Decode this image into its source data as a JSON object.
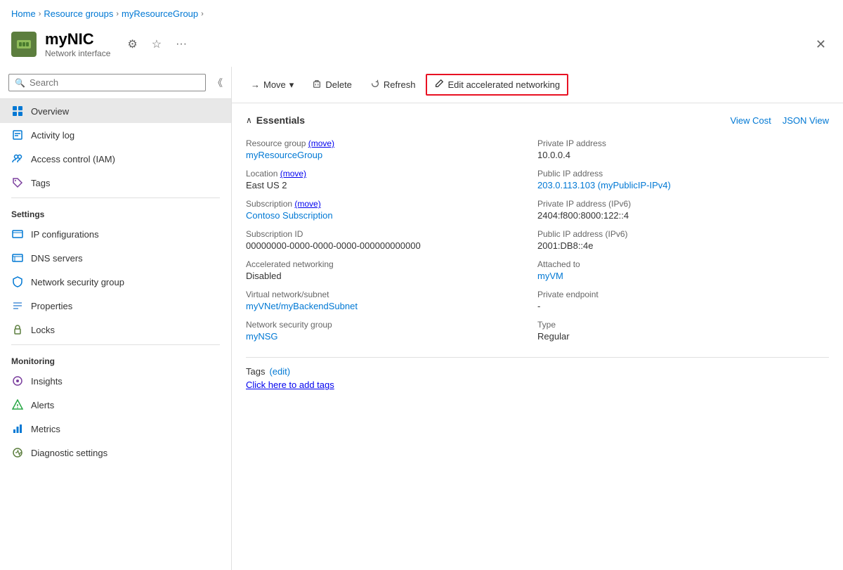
{
  "breadcrumb": {
    "items": [
      "Home",
      "Resource groups",
      "myResourceGroup"
    ]
  },
  "resource": {
    "name": "myNIC",
    "type": "Network interface",
    "icon_bg": "#4a7c2f"
  },
  "header_actions": {
    "pin": "⚙",
    "star": "☆",
    "more": "..."
  },
  "search": {
    "placeholder": "Search"
  },
  "sidebar": {
    "overview": "Overview",
    "sections": [
      {
        "name": "Activity log",
        "icon": "activity"
      },
      {
        "name": "Access control (IAM)",
        "icon": "iam"
      },
      {
        "name": "Tags",
        "icon": "tags"
      }
    ],
    "settings_label": "Settings",
    "settings_items": [
      {
        "name": "IP configurations",
        "icon": "ip"
      },
      {
        "name": "DNS servers",
        "icon": "dns"
      },
      {
        "name": "Network security group",
        "icon": "nsg"
      },
      {
        "name": "Properties",
        "icon": "props"
      },
      {
        "name": "Locks",
        "icon": "locks"
      }
    ],
    "monitoring_label": "Monitoring",
    "monitoring_items": [
      {
        "name": "Insights",
        "icon": "insights"
      },
      {
        "name": "Alerts",
        "icon": "alerts"
      },
      {
        "name": "Metrics",
        "icon": "metrics"
      },
      {
        "name": "Diagnostic settings",
        "icon": "diag"
      }
    ]
  },
  "toolbar": {
    "move_label": "Move",
    "delete_label": "Delete",
    "refresh_label": "Refresh",
    "edit_label": "Edit accelerated networking"
  },
  "essentials": {
    "title": "Essentials",
    "view_cost": "View Cost",
    "json_view": "JSON View",
    "left_fields": [
      {
        "label": "Resource group",
        "value": "myResourceGroup",
        "link": true,
        "suffix": "(move)",
        "suffix_link": true
      },
      {
        "label": "Location",
        "value": "East US 2",
        "link": false,
        "suffix": "(move)",
        "suffix_link": true
      },
      {
        "label": "Subscription",
        "value": "Contoso Subscription",
        "link": true,
        "suffix": "(move)",
        "suffix_link": true
      },
      {
        "label": "Subscription ID",
        "value": "00000000-0000-0000-0000-000000000000",
        "link": false
      },
      {
        "label": "Accelerated networking",
        "value": "Disabled",
        "link": false
      },
      {
        "label": "Virtual network/subnet",
        "value": "myVNet/myBackendSubnet",
        "link": true
      },
      {
        "label": "Network security group",
        "value": "myNSG",
        "link": true
      }
    ],
    "right_fields": [
      {
        "label": "Private IP address",
        "value": "10.0.0.4",
        "link": false
      },
      {
        "label": "Public IP address",
        "value": "203.0.113.103 (myPublicIP-IPv4)",
        "link": true
      },
      {
        "label": "Private IP address (IPv6)",
        "value": "2404:f800:8000:122::4",
        "link": false
      },
      {
        "label": "Public IP address (IPv6)",
        "value": "2001:DB8::4e",
        "link": false
      },
      {
        "label": "Attached to",
        "value": "myVM",
        "link": true
      },
      {
        "label": "Private endpoint",
        "value": "-",
        "link": false
      },
      {
        "label": "Type",
        "value": "Regular",
        "link": false
      }
    ],
    "tags_label": "Tags",
    "tags_edit": "(edit)",
    "tags_add": "Click here to add tags"
  }
}
